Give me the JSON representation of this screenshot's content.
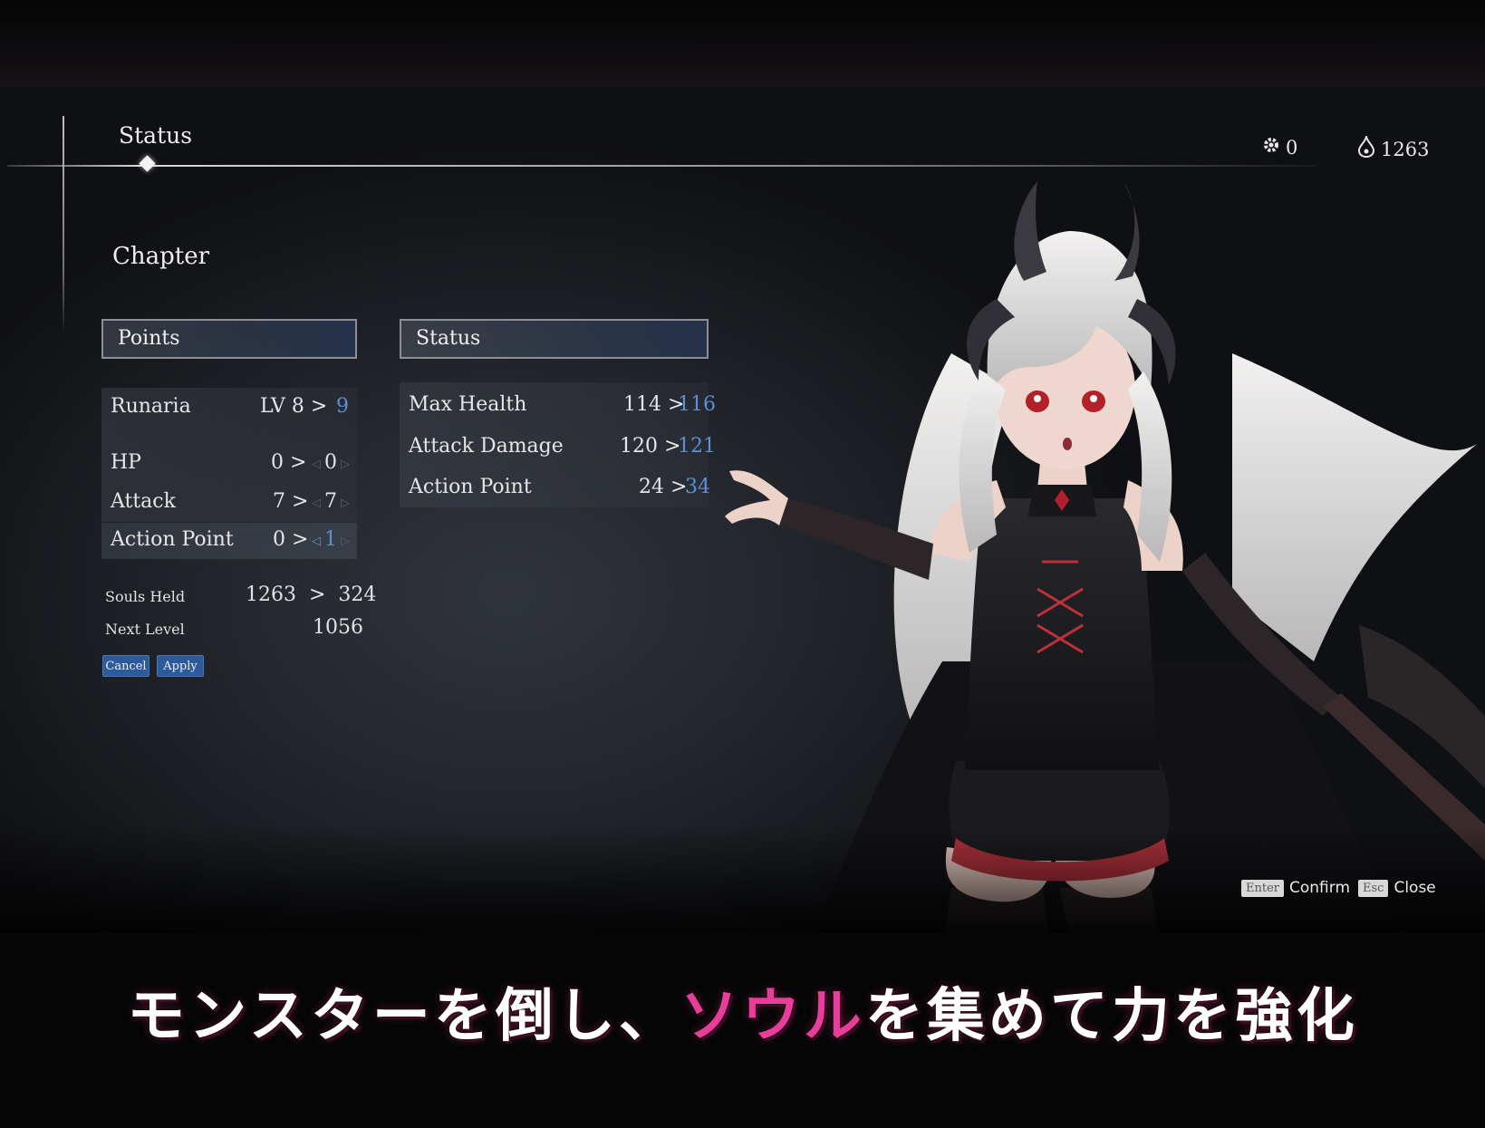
{
  "header": {
    "tab_title": "Status",
    "section_title": "Chapter",
    "gear_count": "0",
    "souls_count": "1263"
  },
  "points_panel": {
    "title": "Points",
    "character_name": "Runaria",
    "level_label": "LV 8",
    "level_arrow": ">",
    "level_new": "9",
    "stats": [
      {
        "label": "HP",
        "current": "0 >",
        "new": "0"
      },
      {
        "label": "Attack",
        "current": "7 >",
        "new": "7"
      },
      {
        "label": "Action Point",
        "current": "0 >",
        "new": "1"
      }
    ],
    "souls_held_label": "Souls Held",
    "souls_held_value": "1263  >  324",
    "next_level_label": "Next Level",
    "next_level_value": "1056",
    "cancel_label": "Cancel",
    "apply_label": "Apply"
  },
  "status_panel": {
    "title": "Status",
    "rows": [
      {
        "label": "Max Health",
        "current": "114 >",
        "new": "116"
      },
      {
        "label": "Attack Damage",
        "current": "120 >",
        "new": "121"
      },
      {
        "label": "Action Point",
        "current": "24 >",
        "new": "34"
      }
    ]
  },
  "hints": {
    "confirm_key": "Enter",
    "confirm_label": "Confirm",
    "close_key": "Esc",
    "close_label": "Close"
  },
  "caption": {
    "part1": "モンスターを倒し、",
    "highlight": "ソウル",
    "part2": "を集めて力を強化"
  },
  "colors": {
    "accent_blue": "#5b8fd6",
    "next_level_red": "#d44e52",
    "caption_pink": "#e83d9a"
  }
}
